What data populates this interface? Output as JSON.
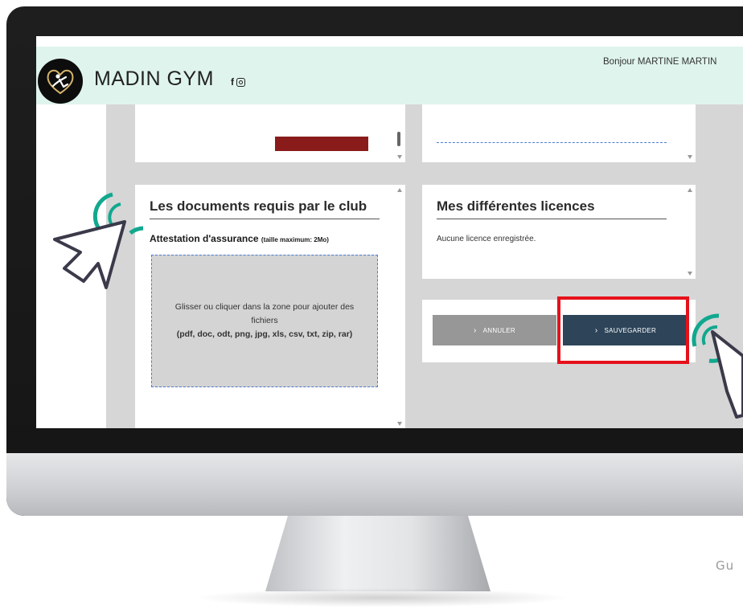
{
  "site": {
    "title": "MADIN GYM",
    "greeting": "Bonjour MARTINE MARTIN"
  },
  "documents_card": {
    "title": "Les documents requis par le club",
    "field_label": "Attestation d'assurance",
    "field_hint": "(taille maximum: 2Mo)",
    "dropzone_text": "Glisser ou cliquer dans la zone pour ajouter des fichiers",
    "dropzone_formats": "(pdf, doc, odt, png, jpg, xls, csv, txt, zip, rar)"
  },
  "licences_card": {
    "title": "Mes différentes licences",
    "empty_text": "Aucune licence enregistrée."
  },
  "actions": {
    "cancel_label": "ANNULER",
    "save_label": "SAUVEGARDER"
  },
  "footer": {
    "brand_partial": "Gu"
  },
  "colors": {
    "header_bg": "#dff4ed",
    "save_button": "#2d4459",
    "cancel_button": "#979797",
    "highlight": "#e5121b",
    "pointer_ring": "#11a88e"
  },
  "icons": [
    "facebook-icon",
    "instagram-icon",
    "logo-gymnast",
    "cursor-arrow-icon",
    "click-ripple-icon",
    "chevron-right-icon"
  ]
}
